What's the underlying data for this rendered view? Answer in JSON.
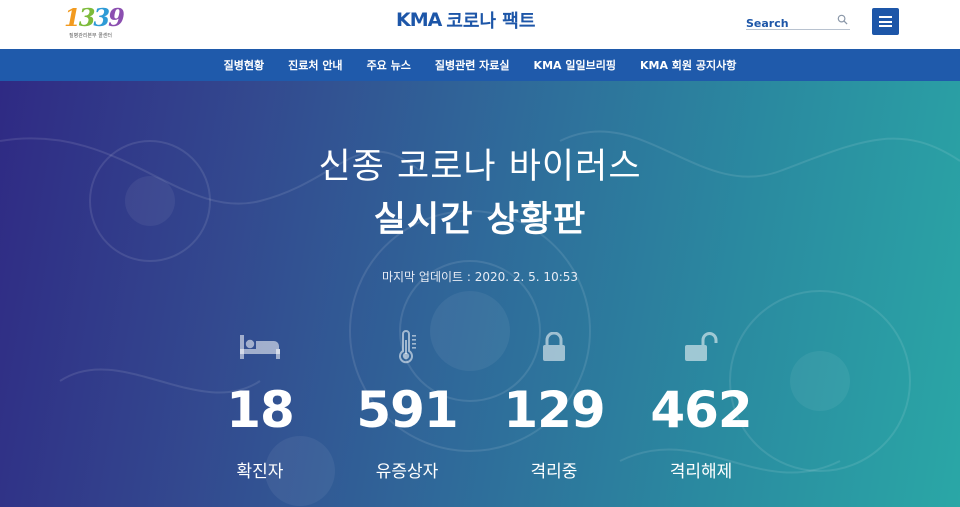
{
  "header": {
    "logo_digits": "1339",
    "logo_caption": "질병관리본부 콜센터",
    "brand_latin": "KMA",
    "brand_korean": "코로나 팩트",
    "search_placeholder": "Search"
  },
  "nav": {
    "items": [
      "질병현황",
      "진료처 안내",
      "주요 뉴스",
      "질병관련 자료실",
      "KMA 일일브리핑",
      "KMA 회원 공지사항"
    ]
  },
  "hero": {
    "title_line1": "신종 코로나 바이러스",
    "title_line2": "실시간 상황판",
    "last_updated": "마지막 업데이트 : 2020. 2. 5. 10:53"
  },
  "stats": [
    {
      "icon": "bed-icon",
      "value": "18",
      "label": "확진자"
    },
    {
      "icon": "thermometer-icon",
      "value": "591",
      "label": "유증상자"
    },
    {
      "icon": "lock-icon",
      "value": "129",
      "label": "격리중"
    },
    {
      "icon": "unlock-icon",
      "value": "462",
      "label": "격리해제"
    }
  ],
  "colors": {
    "brand_blue": "#1d56a8",
    "nav_blue": "#1f5aab",
    "hero_left": "#2f2a84",
    "hero_right": "#2aa7a6"
  }
}
